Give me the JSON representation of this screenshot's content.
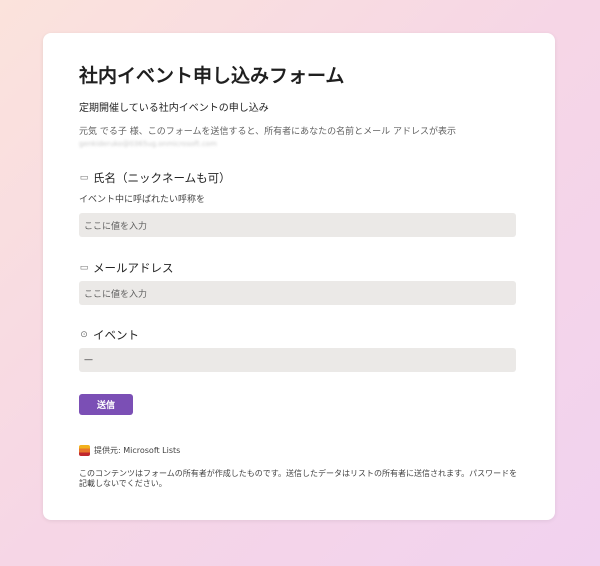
{
  "form": {
    "title": "社内イベント申し込みフォーム",
    "subtitle": "定期開催している社内イベントの申し込み",
    "notice": "元気 でる子 様、このフォームを送信すると、所有者にあなたの名前とメール アドレスが表示",
    "user_email": "genkideruko@0365ug.onmicrosoft.com"
  },
  "questions": [
    {
      "label": "氏名（ニックネームも可）",
      "icon": "text-field-icon",
      "description": "イベント中に呼ばれたい呼称を",
      "placeholder": "ここに値を入力"
    },
    {
      "label": "メールアドレス",
      "icon": "text-field-icon",
      "placeholder": "ここに値を入力"
    },
    {
      "label": "イベント",
      "icon": "choice-circle-icon",
      "value": "—"
    }
  ],
  "submit": {
    "label": "送信",
    "color": "#7b4fb5"
  },
  "footer": {
    "provider": "提供元: Microsoft Lists",
    "disclaimer": "このコンテンツはフォームの所有者が作成したものです。送信したデータはリストの所有者に送信されます。パスワードを記載しないでください。"
  },
  "icons": {
    "text_field": "▭",
    "choice": "⊙"
  },
  "colors": {
    "background_start": "#fbe3dc",
    "background_end": "#f1d2ef",
    "card": "#ffffff",
    "field": "#ebe9e7",
    "accent": "#7b4fb5"
  }
}
